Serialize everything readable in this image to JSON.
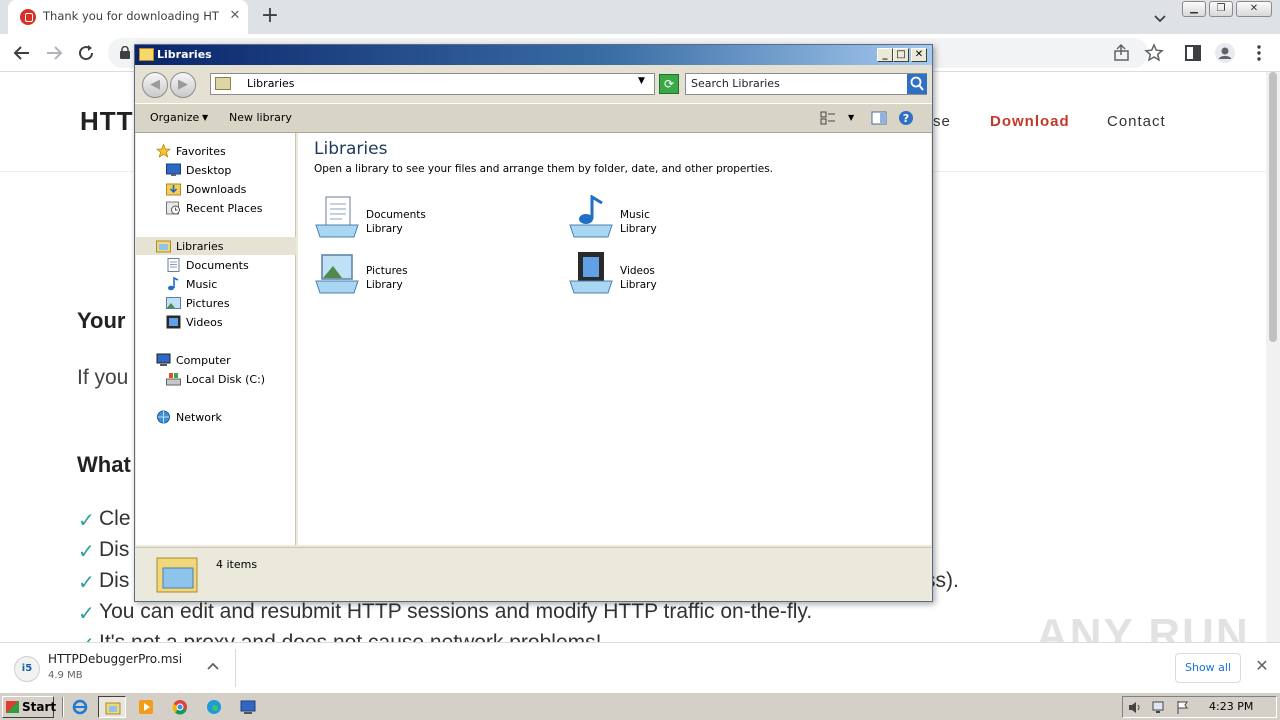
{
  "browser": {
    "tab_title": "Thank you for downloading HTTP De",
    "tab_close": "✕",
    "new_tab": "+",
    "window_controls": {
      "minimize": "▁",
      "restore": "❐",
      "close": "✕"
    }
  },
  "website": {
    "logo": "HTT",
    "nav": {
      "partial": "se",
      "download": "Download",
      "contact": "Contact"
    },
    "headings": {
      "your": "Your",
      "what": "What"
    },
    "paragraph_start": "If you",
    "check": "✓",
    "features": [
      "Cle",
      "Dis",
      "Dis",
      "You can edit and resubmit HTTP sessions and modify HTTP traffic on-the-fly.",
      "It's not a proxy and does not cause network problems!"
    ],
    "feature_tail": "ss)."
  },
  "download_bar": {
    "filename": "HTTPDebuggerPro.msi",
    "size": "4.9 MB",
    "file_icon_text": "i5",
    "show_all": "Show all",
    "close": "✕"
  },
  "explorer": {
    "title": "Libraries",
    "address": "Libraries",
    "search_placeholder": "Search Libraries",
    "commands": {
      "organize": "Organize",
      "new_library": "New library"
    },
    "nav": {
      "favorites": "Favorites",
      "desktop": "Desktop",
      "downloads": "Downloads",
      "recent": "Recent Places",
      "libraries": "Libraries",
      "documents": "Documents",
      "music": "Music",
      "pictures": "Pictures",
      "videos": "Videos",
      "computer": "Computer",
      "local_disk": "Local Disk (C:)",
      "network": "Network"
    },
    "heading": "Libraries",
    "subtitle": "Open a library to see your files and arrange them by folder, date, and other properties.",
    "library_word": "Library",
    "libraries": [
      "Documents",
      "Music",
      "Pictures",
      "Videos"
    ],
    "status": "4 items"
  },
  "taskbar": {
    "start": "Start",
    "clock": "4:23 PM"
  },
  "watermark": "ANY RUN"
}
